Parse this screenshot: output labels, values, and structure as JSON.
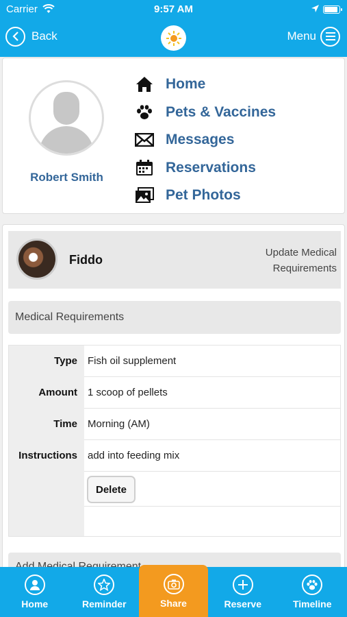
{
  "status_bar": {
    "carrier": "Carrier",
    "time": "9:57 AM"
  },
  "header": {
    "back_label": "Back",
    "menu_label": "Menu",
    "logo_icon": "sun-logo-icon"
  },
  "profile": {
    "user_name": "Robert Smith",
    "nav": [
      {
        "label": "Home",
        "icon": "house-icon"
      },
      {
        "label": "Pets & Vaccines",
        "icon": "paw-icon"
      },
      {
        "label": "Messages",
        "icon": "envelope-icon"
      },
      {
        "label": "Reservations",
        "icon": "calendar-icon"
      },
      {
        "label": "Pet Photos",
        "icon": "photos-icon"
      }
    ]
  },
  "pet": {
    "name": "Fiddo",
    "update_line1": "Update Medical",
    "update_line2": "Requirements"
  },
  "medical": {
    "section_title": "Medical Requirements",
    "rows": [
      {
        "label": "Type",
        "value": "Fish oil supplement"
      },
      {
        "label": "Amount",
        "value": "1 scoop of pellets"
      },
      {
        "label": "Time",
        "value": "Morning (AM)"
      },
      {
        "label": "Instructions",
        "value": "add into feeding mix"
      }
    ],
    "delete_label": "Delete",
    "add_title": "Add Medical Requirement"
  },
  "tabs": [
    {
      "label": "Home",
      "icon": "person-icon"
    },
    {
      "label": "Reminder",
      "icon": "star-icon"
    },
    {
      "label": "Share",
      "icon": "camera-icon",
      "active": true
    },
    {
      "label": "Reserve",
      "icon": "plus-icon"
    },
    {
      "label": "Timeline",
      "icon": "paw-icon"
    }
  ],
  "colors": {
    "primary": "#12a9e8",
    "accent": "#f39a1f",
    "link": "#336699"
  }
}
